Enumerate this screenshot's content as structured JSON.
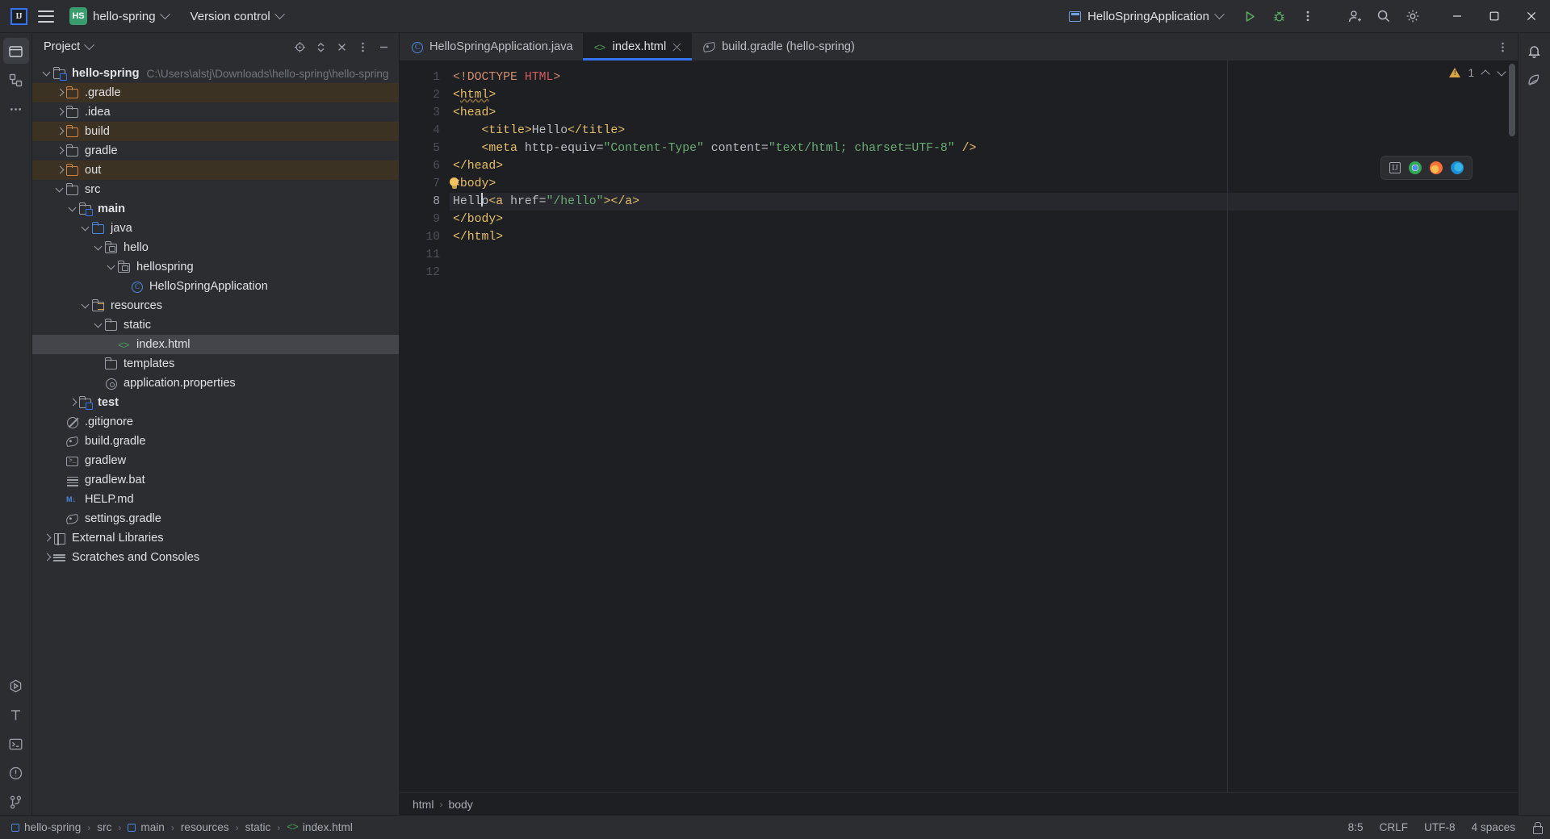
{
  "titlebar": {
    "menu_icon": "hamburger-menu-icon",
    "app_icon": "intellij-idea-logo",
    "project_badge": "HS",
    "project_name": "hello-spring",
    "version_control_label": "Version control",
    "run_config_name": "HelloSpringApplication",
    "run_icon": "run-icon",
    "debug_icon": "debug-icon",
    "more_icon": "more-vertical-icon",
    "account_icon": "account-icon",
    "search_icon": "search-icon",
    "settings_icon": "settings-gear-icon",
    "minimize_icon": "minimize-icon",
    "maximize_icon": "maximize-icon",
    "close_icon": "close-icon"
  },
  "left_rail": {
    "items": [
      {
        "name": "project-tool-window",
        "icon": "folder-icon",
        "active": true
      },
      {
        "name": "commit-tool-window",
        "icon": "structure-icon",
        "active": false
      },
      {
        "name": "more-tool-windows",
        "icon": "more-horizontal-icon",
        "active": false
      }
    ],
    "bottom_items": [
      {
        "name": "run-tool-window",
        "icon": "run-hex-icon"
      },
      {
        "name": "todo-tool-window",
        "icon": "todo-t-icon"
      },
      {
        "name": "terminal-tool-window",
        "icon": "terminal-icon"
      },
      {
        "name": "problems-tool-window",
        "icon": "problems-circle-icon"
      },
      {
        "name": "version-control-tool-window",
        "icon": "git-branch-icon"
      }
    ]
  },
  "right_rail": {
    "items": [
      {
        "name": "notifications",
        "icon": "bell-icon"
      },
      {
        "name": "ai-assistant",
        "icon": "ai-assistant-icon"
      }
    ]
  },
  "project_panel": {
    "title": "Project",
    "toolbar": [
      {
        "name": "select-opened-file",
        "icon": "target-icon"
      },
      {
        "name": "expand-collapse",
        "icon": "collapse-all-icon"
      },
      {
        "name": "hide-tool-window-x",
        "icon": "close-x-icon"
      },
      {
        "name": "options-menu",
        "icon": "more-vertical-icon"
      },
      {
        "name": "minimize-panel",
        "icon": "minimize-dash-icon"
      }
    ],
    "tree": [
      {
        "depth": 0,
        "arrow": "down",
        "icon": "module-folder-icon",
        "label": "hello-spring",
        "bold": true,
        "path": "C:\\Users\\alstj\\Downloads\\hello-spring\\hello-spring"
      },
      {
        "depth": 1,
        "arrow": "right",
        "icon": "folder-orange-icon",
        "label": ".gradle",
        "excluded": true
      },
      {
        "depth": 1,
        "arrow": "right",
        "icon": "folder-icon",
        "label": ".idea"
      },
      {
        "depth": 1,
        "arrow": "right",
        "icon": "folder-orange-icon",
        "label": "build",
        "excluded": true
      },
      {
        "depth": 1,
        "arrow": "right",
        "icon": "folder-icon",
        "label": "gradle"
      },
      {
        "depth": 1,
        "arrow": "right",
        "icon": "folder-orange-icon",
        "label": "out",
        "excluded": true
      },
      {
        "depth": 1,
        "arrow": "down",
        "icon": "folder-icon",
        "label": "src"
      },
      {
        "depth": 2,
        "arrow": "down",
        "icon": "module-folder-icon",
        "label": "main",
        "bold": true
      },
      {
        "depth": 3,
        "arrow": "down",
        "icon": "source-root-blue-icon",
        "label": "java"
      },
      {
        "depth": 4,
        "arrow": "down",
        "icon": "package-icon",
        "label": "hello"
      },
      {
        "depth": 5,
        "arrow": "down",
        "icon": "package-icon",
        "label": "hellospring"
      },
      {
        "depth": 6,
        "arrow": "none",
        "icon": "java-class-icon",
        "label": "HelloSpringApplication"
      },
      {
        "depth": 3,
        "arrow": "down",
        "icon": "resource-root-icon",
        "label": "resources"
      },
      {
        "depth": 4,
        "arrow": "down",
        "icon": "folder-icon",
        "label": "static"
      },
      {
        "depth": 5,
        "arrow": "none",
        "icon": "html-file-icon",
        "label": "index.html",
        "selected": true
      },
      {
        "depth": 4,
        "arrow": "none",
        "icon": "folder-icon",
        "label": "templates"
      },
      {
        "depth": 4,
        "arrow": "none",
        "icon": "properties-file-icon",
        "label": "application.properties"
      },
      {
        "depth": 2,
        "arrow": "right",
        "icon": "module-folder-icon",
        "label": "test",
        "bold": true
      },
      {
        "depth": 1,
        "arrow": "none",
        "icon": "gitignore-icon",
        "label": ".gitignore"
      },
      {
        "depth": 1,
        "arrow": "none",
        "icon": "gradle-file-icon",
        "label": "build.gradle"
      },
      {
        "depth": 1,
        "arrow": "none",
        "icon": "shell-script-icon",
        "label": "gradlew"
      },
      {
        "depth": 1,
        "arrow": "none",
        "icon": "text-file-icon",
        "label": "gradlew.bat"
      },
      {
        "depth": 1,
        "arrow": "none",
        "icon": "markdown-file-icon",
        "label": "HELP.md"
      },
      {
        "depth": 1,
        "arrow": "none",
        "icon": "gradle-file-icon",
        "label": "settings.gradle"
      },
      {
        "depth": 0,
        "arrow": "right",
        "icon": "external-libraries-icon",
        "label": "External Libraries"
      },
      {
        "depth": 0,
        "arrow": "right",
        "icon": "scratches-icon",
        "label": "Scratches and Consoles"
      }
    ]
  },
  "editor": {
    "tabs": [
      {
        "label": "HelloSpringApplication.java",
        "icon": "java-class-icon",
        "active": false,
        "closable": false
      },
      {
        "label": "index.html",
        "icon": "html-file-icon",
        "active": true,
        "closable": true
      },
      {
        "label": "build.gradle (hello-spring)",
        "icon": "gradle-file-icon",
        "active": false,
        "closable": false
      }
    ],
    "tab_options_icon": "more-vertical-icon",
    "line_numbers": [
      "1",
      "2",
      "3",
      "4",
      "5",
      "6",
      "7",
      "8",
      "9",
      "10",
      "11",
      "12"
    ],
    "current_line": 8,
    "intention_bulb_line": 7,
    "lines": [
      "<!DOCTYPE HTML>",
      "<html>",
      "<head>",
      "    <title>Hello</title>",
      "    <meta http-equiv=\"Content-Type\" content=\"text/html; charset=UTF-8\" />",
      "</head>",
      "<body>",
      "Hello<a href=\"/hello\"></a>",
      "</body>",
      "</html>",
      "",
      ""
    ],
    "inspection": {
      "warning_count": "1",
      "warning_icon": "warning-triangle-icon",
      "prev_icon": "chevron-up-icon",
      "next_icon": "chevron-down-icon"
    },
    "browser_preview": {
      "icons": [
        "intellij-browser-icon",
        "chrome-icon",
        "firefox-icon",
        "edge-icon"
      ]
    },
    "breadcrumbs": [
      "html",
      "body"
    ]
  },
  "statusbar": {
    "path": [
      {
        "label": "hello-spring",
        "icon": "module-icon"
      },
      {
        "label": "src",
        "icon": ""
      },
      {
        "label": "main",
        "icon": "module-icon"
      },
      {
        "label": "resources",
        "icon": ""
      },
      {
        "label": "static",
        "icon": ""
      },
      {
        "label": "index.html",
        "icon": "html-file-icon"
      }
    ],
    "caret_position": "8:5",
    "line_separator": "CRLF",
    "encoding": "UTF-8",
    "indent": "4 spaces",
    "lock_icon": "read-only-lock-icon"
  },
  "colors": {
    "bg_editor": "#1e1f22",
    "bg_panel": "#2b2d30",
    "accent_blue": "#3574f0",
    "excluded_row": "#3c3223",
    "selected_row": "#43454a",
    "tag": "#e8bf6a",
    "string": "#6aab73",
    "doctype_kw": "#cf8e6d",
    "doctype_html": "#d05b5b",
    "green_run": "#59a869",
    "project_badge": "#3a9d6e"
  }
}
